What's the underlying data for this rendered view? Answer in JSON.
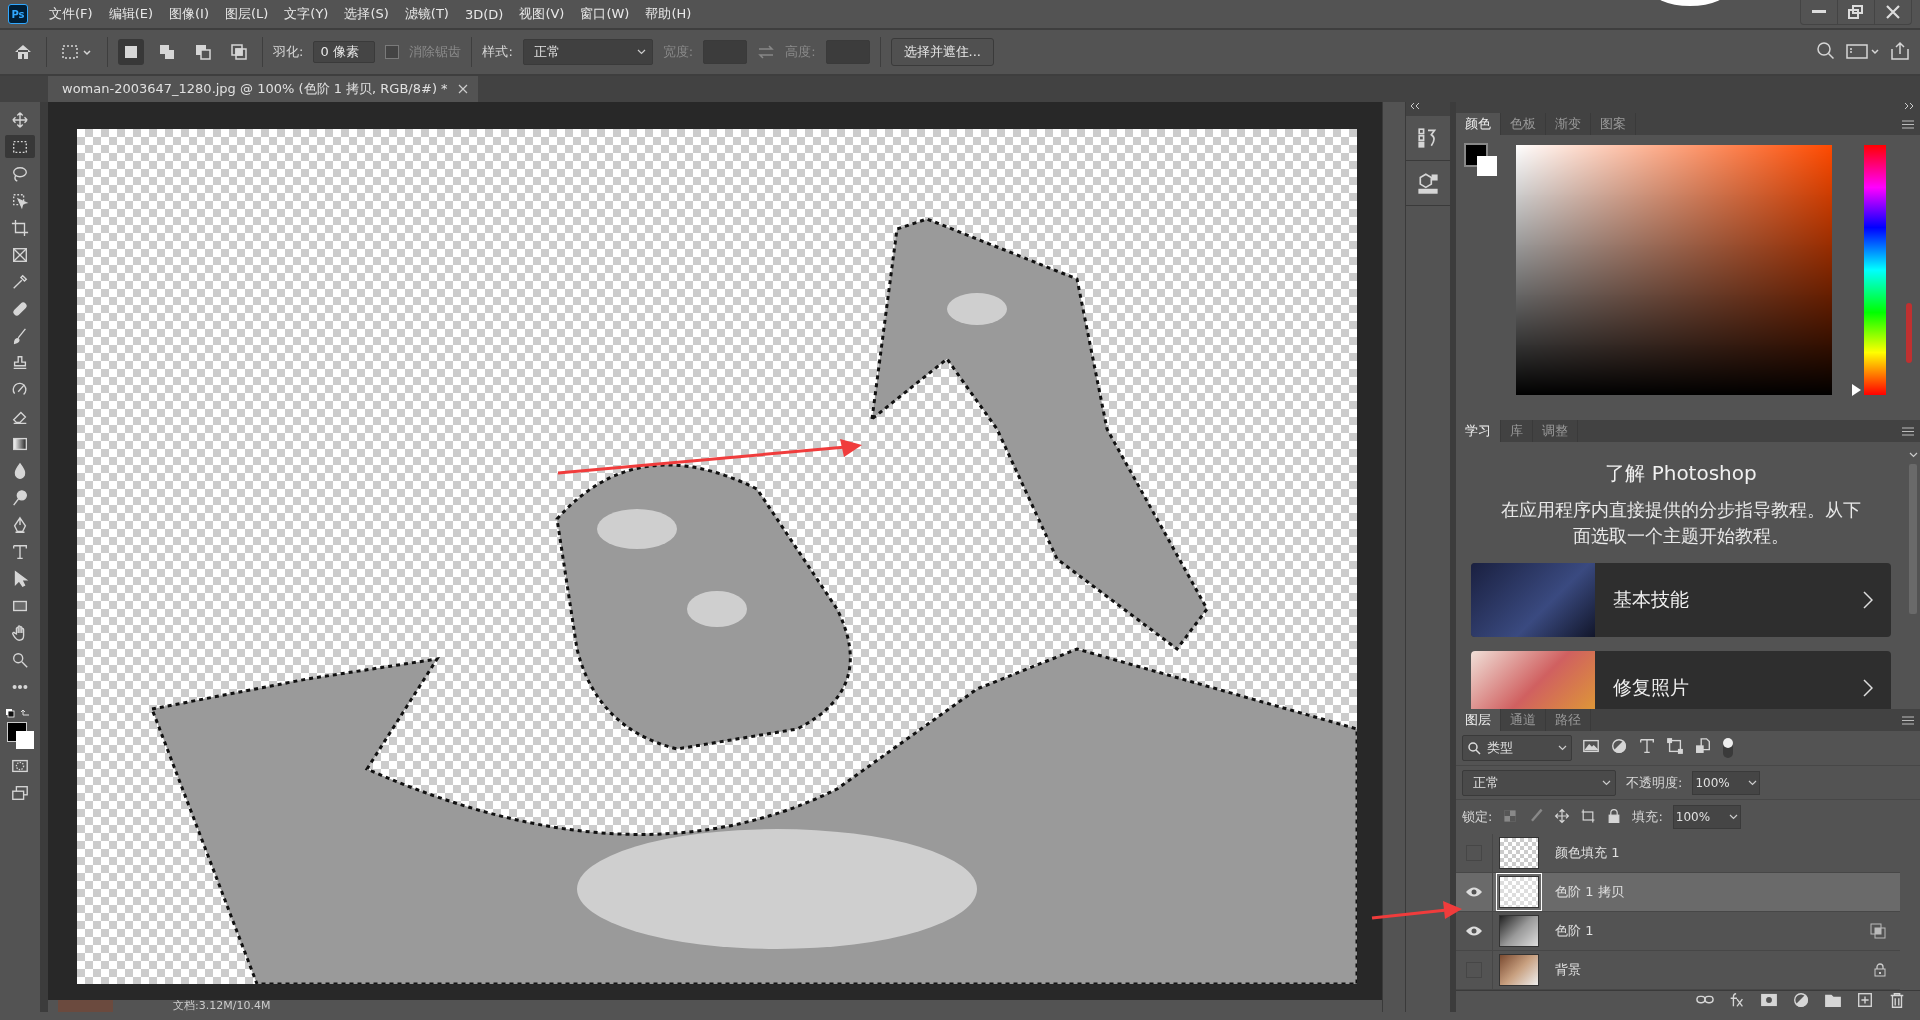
{
  "app_icon": "Ps",
  "menu": [
    "文件(F)",
    "编辑(E)",
    "图像(I)",
    "图层(L)",
    "文字(Y)",
    "选择(S)",
    "滤镜(T)",
    "3D(D)",
    "视图(V)",
    "窗口(W)",
    "帮助(H)"
  ],
  "options_bar": {
    "selection_modes": [
      {
        "kind": "new",
        "selected": true
      },
      {
        "kind": "add",
        "selected": false
      },
      {
        "kind": "subtract",
        "selected": false
      },
      {
        "kind": "intersect",
        "selected": false
      }
    ],
    "feather_label": "羽化:",
    "feather_value": "0 像素",
    "antialias": {
      "label": "消除锯齿",
      "checked": false,
      "disabled": true
    },
    "style_label": "样式:",
    "style_value": "正常",
    "width_label": "宽度:",
    "height_label": "高度:",
    "select_mask_button": "选择并遮住..."
  },
  "document_tab": {
    "title": "woman-2003647_1280.jpg @ 100% (色阶 1 拷贝, RGB/8#) *"
  },
  "tools": [
    {
      "kind": "move",
      "selected": false
    },
    {
      "kind": "marquee",
      "selected": true
    },
    {
      "kind": "lasso",
      "selected": false
    },
    {
      "kind": "object-select",
      "selected": false
    },
    {
      "kind": "crop",
      "selected": false
    },
    {
      "kind": "frame",
      "selected": false
    },
    {
      "kind": "eyedropper",
      "selected": false
    },
    {
      "kind": "bandage",
      "selected": false
    },
    {
      "kind": "brush",
      "selected": false
    },
    {
      "kind": "stamp",
      "selected": false
    },
    {
      "kind": "history-brush",
      "selected": false
    },
    {
      "kind": "eraser",
      "selected": false
    },
    {
      "kind": "gradient",
      "selected": false
    },
    {
      "kind": "drop",
      "selected": false
    },
    {
      "kind": "dodge",
      "selected": false
    },
    {
      "kind": "pen",
      "selected": false
    },
    {
      "kind": "type",
      "selected": false
    },
    {
      "kind": "pointer",
      "selected": false
    },
    {
      "kind": "rectangle",
      "selected": false
    },
    {
      "kind": "hand",
      "selected": false
    },
    {
      "kind": "zoom",
      "selected": false
    },
    {
      "kind": "more",
      "selected": false
    }
  ],
  "color_panel": {
    "hue_slider": {
      "level": 0.02
    },
    "tabs": [
      {
        "label": "颜色",
        "selected": true
      },
      {
        "label": "色板",
        "selected": false
      },
      {
        "label": "渐变",
        "selected": false
      },
      {
        "label": "图案",
        "selected": false
      }
    ]
  },
  "learn_panel": {
    "tabs": [
      {
        "label": "学习",
        "selected": true
      },
      {
        "label": "库",
        "selected": false
      },
      {
        "label": "调整",
        "selected": false
      }
    ],
    "title": "了解 Photoshop",
    "description": "在应用程序内直接提供的分步指导教程。从下面选取一个主题开始教程。",
    "cards": [
      {
        "kind": "night-room",
        "label": "基本技能"
      },
      {
        "kind": "flowers",
        "label": "修复照片"
      }
    ]
  },
  "layers_panel": {
    "tabs": [
      {
        "label": "图层",
        "selected": true
      },
      {
        "label": "通道",
        "selected": false
      },
      {
        "label": "路径",
        "selected": false
      }
    ],
    "filter": "类型",
    "blend_mode": "正常",
    "opacity_label": "不透明度:",
    "opacity": "100%",
    "lock_label": "锁定:",
    "fill_label": "填充:",
    "fill": "100%",
    "layers": [
      {
        "name": "颜色填充 1",
        "kind": "fill",
        "visible": false,
        "selected": false,
        "locked": false
      },
      {
        "name": "色阶 1 拷贝",
        "kind": "smart-copy",
        "visible": true,
        "selected": true,
        "locked": false
      },
      {
        "name": "色阶 1",
        "kind": "smart-object",
        "visible": true,
        "selected": false,
        "locked": false
      },
      {
        "name": "背景",
        "kind": "background",
        "visible": false,
        "selected": false,
        "locked": true
      }
    ]
  },
  "status_bar": {
    "text": "文档:3.12M/10.4M"
  }
}
